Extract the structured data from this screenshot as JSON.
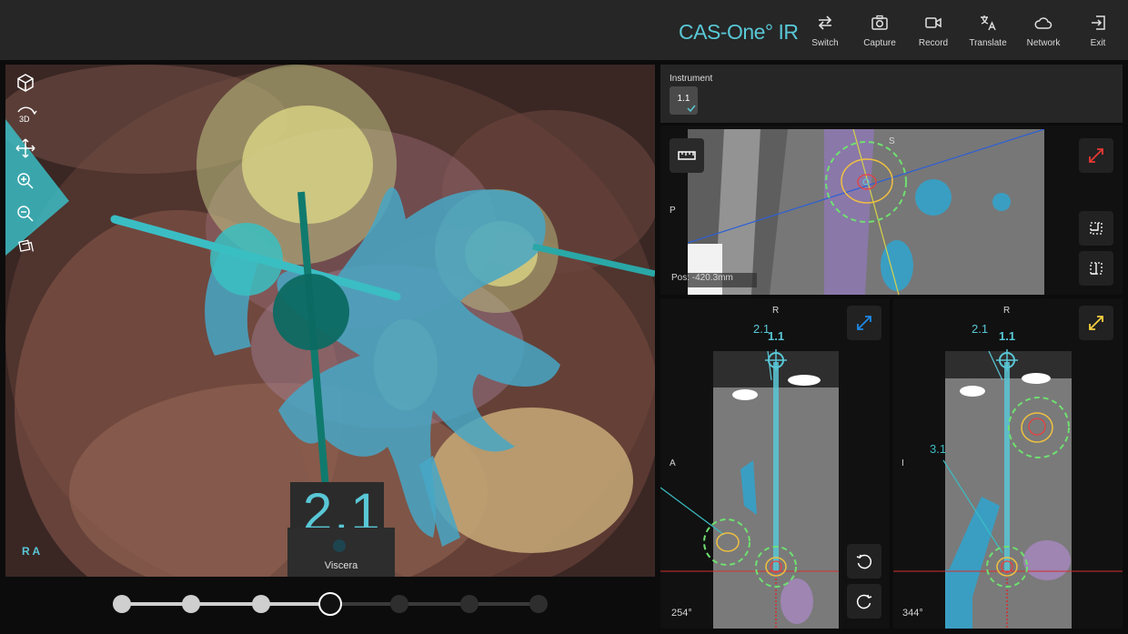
{
  "app": {
    "title": "CAS-One° IR"
  },
  "toolbar": {
    "switch": "Switch",
    "capture": "Capture",
    "record": "Record",
    "translate": "Translate",
    "network": "Network",
    "exit": "Exit"
  },
  "viewport3d": {
    "tools": [
      "cube-icon",
      "3d-rotate-icon",
      "pan-icon",
      "zoom-in-icon",
      "zoom-out-icon",
      "rotate-view-icon"
    ],
    "tool_3d_label": "3D",
    "orientation": "R A",
    "instrument_number": "2.1",
    "structure_label": "Viscera"
  },
  "timeline": {
    "steps": 6,
    "current_step": 4
  },
  "instrument": {
    "title": "Instrument",
    "selected": "1.1"
  },
  "views": {
    "top": {
      "label_s": "S",
      "label_p": "P",
      "position": "Pos: -420.3mm"
    },
    "bottom_left": {
      "label_r": "R",
      "label_a": "A",
      "needle_secondary": "2.1",
      "needle_primary": "1.1",
      "angle": "254°"
    },
    "bottom_right": {
      "label_r": "R",
      "label_i": "I",
      "needle_secondary": "2.1",
      "needle_primary": "1.1",
      "needle_other": "3.1",
      "angle": "344°"
    }
  },
  "colors": {
    "accent": "#59c7d6",
    "expand_red": "#e53935",
    "expand_blue": "#1e88e5",
    "expand_yellow": "#f4d03f"
  }
}
